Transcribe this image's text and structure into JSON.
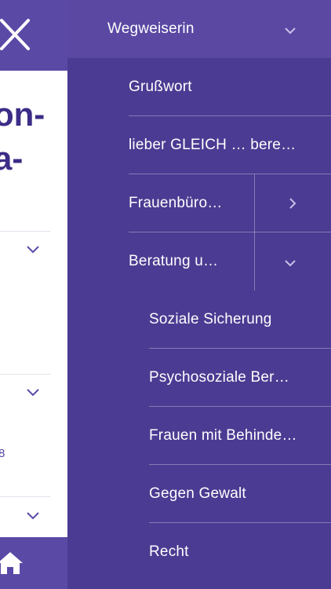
{
  "background_page": {
    "title_lines": [
      "on-",
      "a-"
    ],
    "small_text": "8"
  },
  "drawer": {
    "header": {
      "label": "Wegweiserin",
      "expanded": true
    },
    "items": [
      {
        "label": "Grußwort",
        "level": 1
      },
      {
        "label": "lieber GLEICH … bere…",
        "level": 1
      },
      {
        "label": "Frauenbüro…",
        "level": 1,
        "chevron": "chevron-right"
      },
      {
        "label": "Beratung u…",
        "level": 1,
        "chevron": "chevron-down"
      },
      {
        "label": "Soziale Sicherung",
        "level": 2
      },
      {
        "label": "Psychosoziale Ber…",
        "level": 2
      },
      {
        "label": "Frauen mit Behinde…",
        "level": 2
      },
      {
        "label": "Gegen Gewalt",
        "level": 2
      },
      {
        "label": "Recht",
        "level": 2
      }
    ]
  },
  "colors": {
    "drawer_bg": "#4c3b92",
    "drawer_header_bg": "#5a48a3",
    "title_text": "#3d2c87",
    "text": "#ffffff"
  },
  "icons": {
    "close": "close-icon",
    "home": "home-icon",
    "chevron_down": "chevron-down-icon",
    "chevron_right": "chevron-right-icon"
  }
}
